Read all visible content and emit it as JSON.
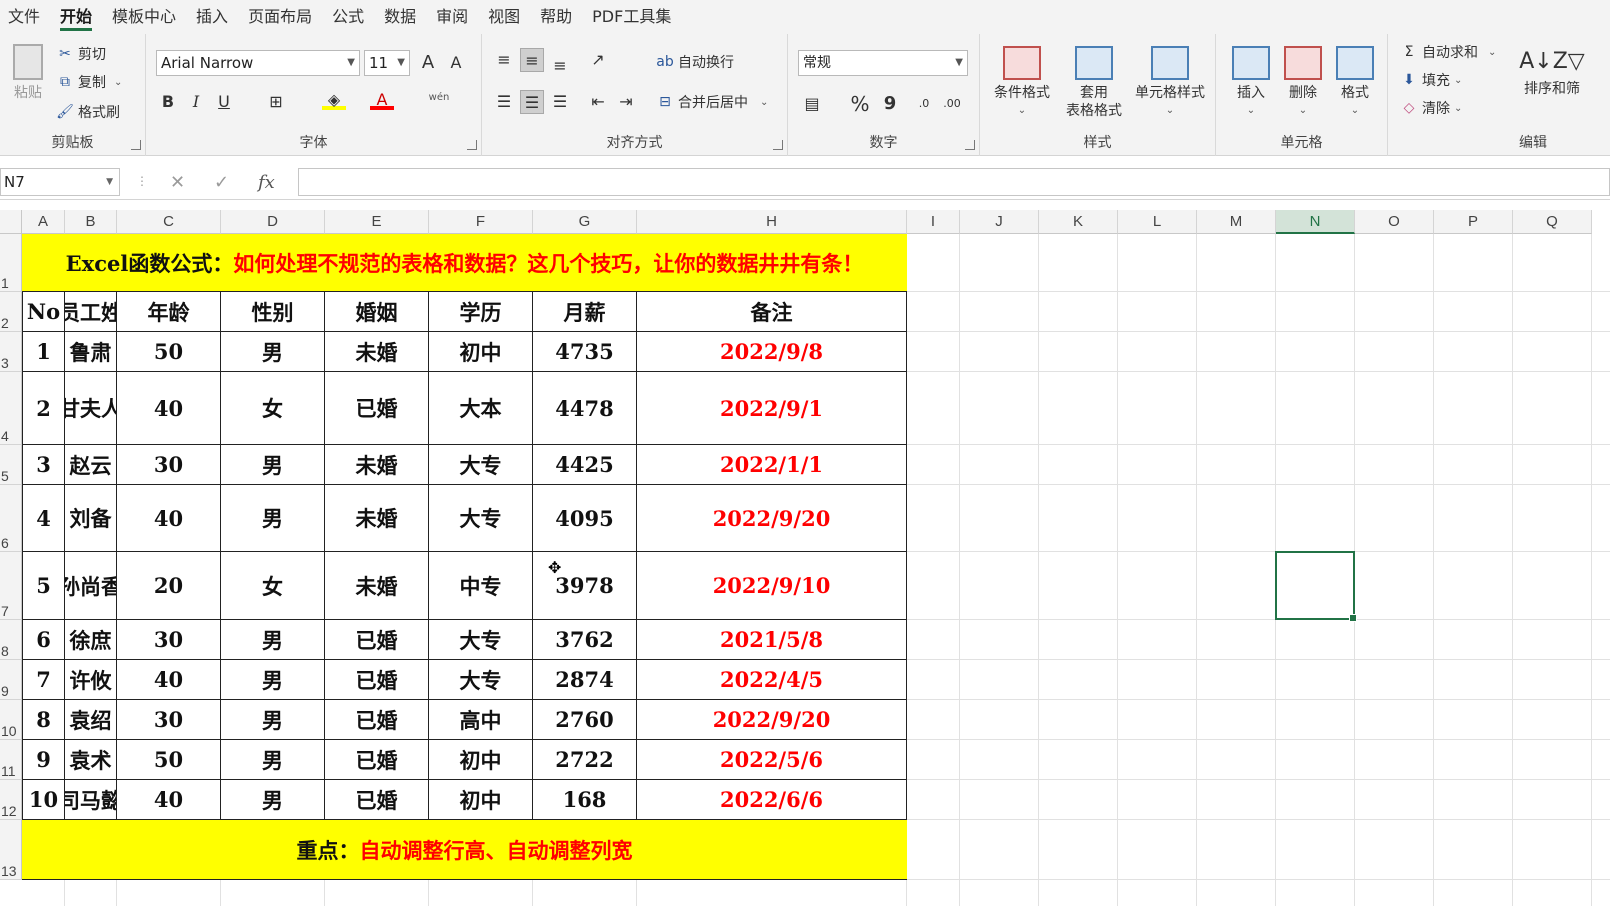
{
  "menu": [
    "文件",
    "开始",
    "模板中心",
    "插入",
    "页面布局",
    "公式",
    "数据",
    "审阅",
    "视图",
    "帮助",
    "PDF工具集"
  ],
  "menu_active": "开始",
  "ribbon": {
    "clipboard": {
      "label": "剪贴板",
      "paste": "粘贴",
      "cut": "剪切",
      "copy": "复制",
      "format_painter": "格式刷"
    },
    "font": {
      "label": "字体",
      "font_name": "Arial Narrow",
      "font_size": "11",
      "bold": "B",
      "italic": "I",
      "underline": "U",
      "grow": "A",
      "shrink": "A",
      "font_color": "A",
      "phonetic": "wén"
    },
    "alignment": {
      "label": "对齐方式",
      "wrap_text": "自动换行",
      "merge_center": "合并后居中"
    },
    "number": {
      "label": "数字",
      "format": "常规",
      "percent": "%",
      "comma": "9"
    },
    "styles": {
      "label": "样式",
      "conditional": "条件格式",
      "table_format_1": "套用",
      "table_format_2": "表格格式",
      "cell_styles": "单元格样式"
    },
    "cells": {
      "label": "单元格",
      "insert": "插入",
      "delete": "删除",
      "format": "格式"
    },
    "editing": {
      "label": "编辑",
      "autosum": "自动求和",
      "fill": "填充",
      "clear": "清除",
      "sort_filter": "排序和筛"
    }
  },
  "formula_bar": {
    "name_box": "N7",
    "fx": "fx",
    "value": ""
  },
  "columns": [
    "A",
    "B",
    "C",
    "D",
    "E",
    "F",
    "G",
    "H",
    "I",
    "J",
    "K",
    "L",
    "M",
    "N",
    "O",
    "P",
    "Q"
  ],
  "selected_column": "N",
  "rows": [
    "1",
    "2",
    "3",
    "4",
    "5",
    "6",
    "7",
    "8",
    "9",
    "10",
    "11",
    "12",
    "13"
  ],
  "title_banner": {
    "black": "Excel函数公式：",
    "red": "如何处理不规范的表格和数据？这几个技巧，让你的数据井井有条！"
  },
  "table": {
    "headers": [
      "No",
      "员工姓",
      "年龄",
      "性别",
      "婚姻",
      "学历",
      "月薪",
      "备注"
    ],
    "rows": [
      [
        "1",
        "鲁肃",
        "50",
        "男",
        "未婚",
        "初中",
        "4735",
        "2022/9/8"
      ],
      [
        "2",
        "甘夫人",
        "40",
        "女",
        "已婚",
        "大本",
        "4478",
        "2022/9/1"
      ],
      [
        "3",
        "赵云",
        "30",
        "男",
        "未婚",
        "大专",
        "4425",
        "2022/1/1"
      ],
      [
        "4",
        "刘备",
        "40",
        "男",
        "未婚",
        "大专",
        "4095",
        "2022/9/20"
      ],
      [
        "5",
        "孙尚香",
        "20",
        "女",
        "未婚",
        "中专",
        "3978",
        "2022/9/10"
      ],
      [
        "6",
        "徐庶",
        "30",
        "男",
        "已婚",
        "大专",
        "3762",
        "2021/5/8"
      ],
      [
        "7",
        "许攸",
        "40",
        "男",
        "已婚",
        "大专",
        "2874",
        "2022/4/5"
      ],
      [
        "8",
        "袁绍",
        "30",
        "男",
        "已婚",
        "高中",
        "2760",
        "2022/9/20"
      ],
      [
        "9",
        "袁术",
        "50",
        "男",
        "已婚",
        "初中",
        "2722",
        "2022/5/6"
      ],
      [
        "10",
        "司马懿",
        "40",
        "男",
        "已婚",
        "初中",
        "168",
        "2022/6/6"
      ]
    ]
  },
  "footer_banner": {
    "black": "重点：",
    "red": "自动调整行高、自动调整列宽"
  },
  "colors": {
    "accent": "#217346",
    "banner": "#ffff00",
    "note_red": "#ff0000"
  }
}
